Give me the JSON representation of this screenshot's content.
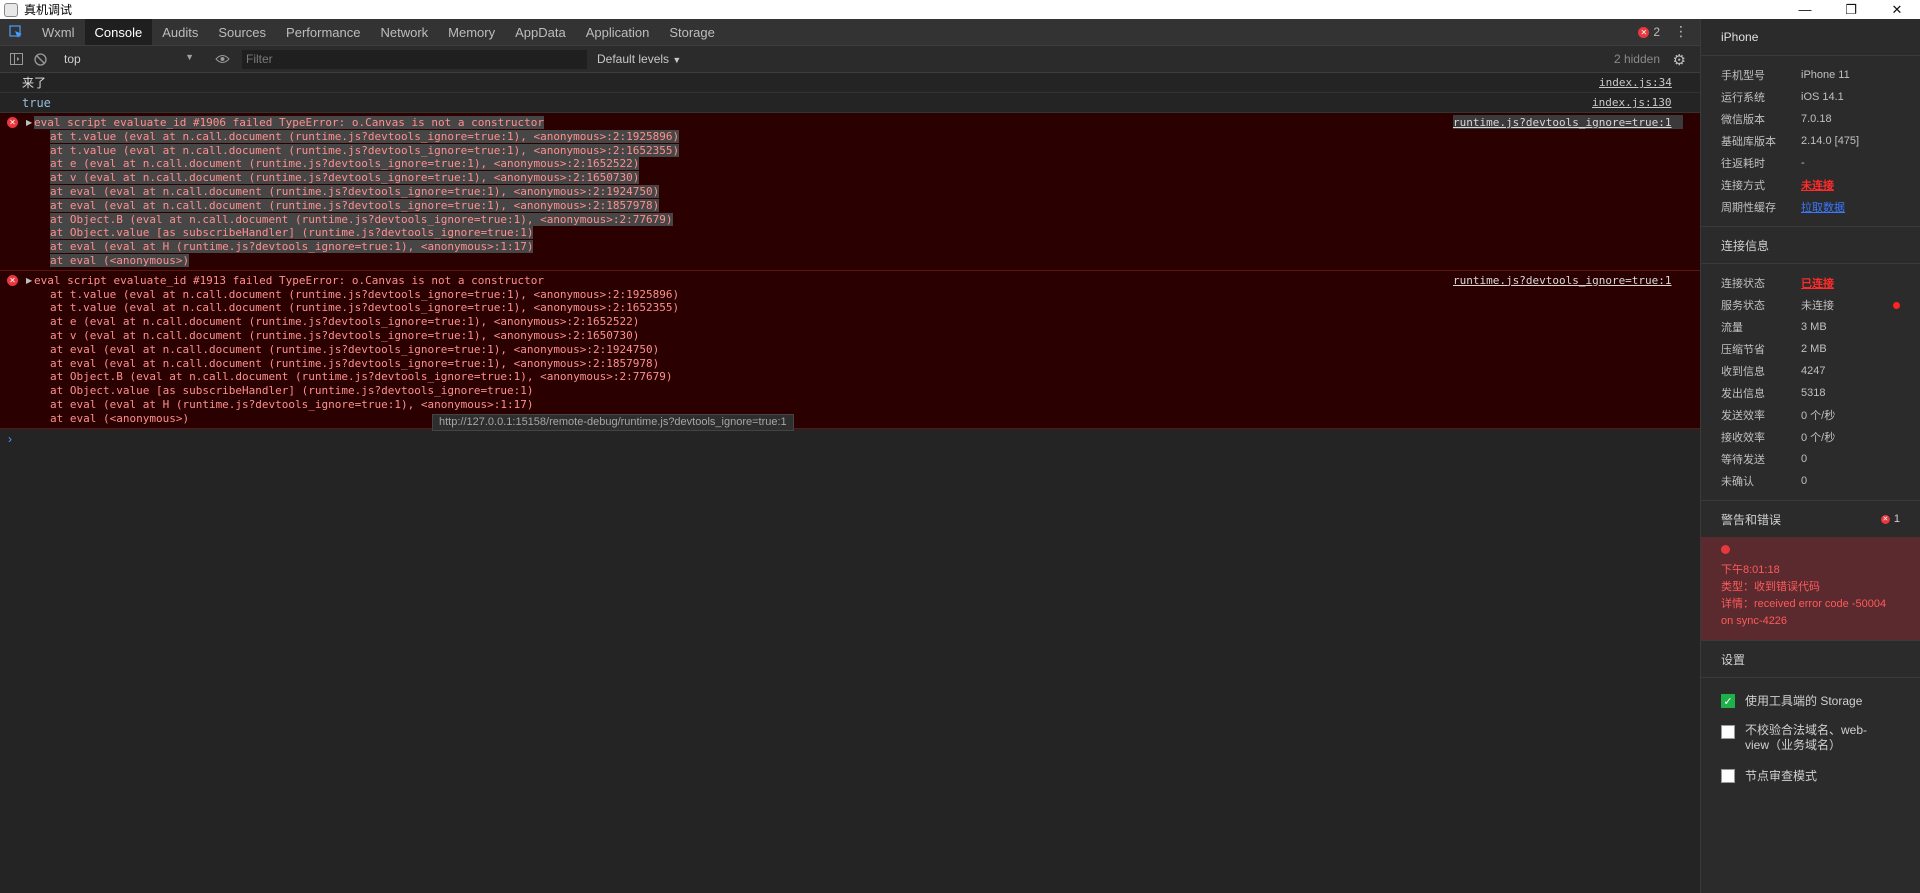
{
  "window": {
    "title": "真机调试",
    "controls": [
      "—",
      "❐",
      "✕"
    ]
  },
  "tabs": [
    "Wxml",
    "Console",
    "Audits",
    "Sources",
    "Performance",
    "Network",
    "Memory",
    "AppData",
    "Application",
    "Storage"
  ],
  "active_tab": "Console",
  "error_badge": "2",
  "toolbar": {
    "context": "top",
    "filter_placeholder": "Filter",
    "levels": "Default levels",
    "hidden": "2 hidden"
  },
  "console": {
    "logs": [
      {
        "text": "来了",
        "source": "index.js:34"
      },
      {
        "text": "true",
        "source": "index.js:130"
      }
    ],
    "errors": [
      {
        "message": "eval script evaluate_id #1906 failed TypeError: o.Canvas is not a constructor",
        "source": "runtime.js?devtools_ignore=true:1",
        "frames": [
          "at t.value (eval at n.call.document (runtime.js?devtools_ignore=true:1), <anonymous>:2:1925896)",
          "at t.value (eval at n.call.document (runtime.js?devtools_ignore=true:1), <anonymous>:2:1652355)",
          "at e (eval at n.call.document (runtime.js?devtools_ignore=true:1), <anonymous>:2:1652522)",
          "at v (eval at n.call.document (runtime.js?devtools_ignore=true:1), <anonymous>:2:1650730)",
          "at eval (eval at n.call.document (runtime.js?devtools_ignore=true:1), <anonymous>:2:1924750)",
          "at eval (eval at n.call.document (runtime.js?devtools_ignore=true:1), <anonymous>:2:1857978)",
          "at Object.B (eval at n.call.document (runtime.js?devtools_ignore=true:1), <anonymous>:2:77679)",
          "at Object.value [as subscribeHandler] (runtime.js?devtools_ignore=true:1)",
          "at eval (eval at H (runtime.js?devtools_ignore=true:1), <anonymous>:1:17)",
          "at eval (<anonymous>)"
        ]
      },
      {
        "message": "eval script evaluate_id #1913 failed TypeError: o.Canvas is not a constructor",
        "source": "runtime.js?devtools_ignore=true:1",
        "frames": [
          "at t.value (eval at n.call.document (runtime.js?devtools_ignore=true:1), <anonymous>:2:1925896)",
          "at t.value (eval at n.call.document (runtime.js?devtools_ignore=true:1), <anonymous>:2:1652355)",
          "at e (eval at n.call.document (runtime.js?devtools_ignore=true:1), <anonymous>:2:1652522)",
          "at v (eval at n.call.document (runtime.js?devtools_ignore=true:1), <anonymous>:2:1650730)",
          "at eval (eval at n.call.document (runtime.js?devtools_ignore=true:1), <anonymous>:2:1924750)",
          "at eval (eval at n.call.document (runtime.js?devtools_ignore=true:1), <anonymous>:2:1857978)",
          "at Object.B (eval at n.call.document (runtime.js?devtools_ignore=true:1), <anonymous>:2:77679)",
          "at Object.value [as subscribeHandler] (runtime.js?devtools_ignore=true:1)",
          "at eval (eval at H (runtime.js?devtools_ignore=true:1), <anonymous>:1:17)",
          "at eval (<anonymous>)"
        ]
      }
    ],
    "tooltip": "http://127.0.0.1:15158/remote-debug/runtime.js?devtools_ignore=true:1"
  },
  "sidebar": {
    "device": "iPhone",
    "device_info": [
      {
        "k": "手机型号",
        "v": "iPhone 11"
      },
      {
        "k": "运行系统",
        "v": "iOS 14.1"
      },
      {
        "k": "微信版本",
        "v": "7.0.18"
      },
      {
        "k": "基础库版本",
        "v": "2.14.0 [475]"
      },
      {
        "k": "往返耗时",
        "v": "-"
      },
      {
        "k": "连接方式",
        "v": "未连接"
      },
      {
        "k": "周期性缓存",
        "v": "拉取数据"
      }
    ],
    "conn_title": "连接信息",
    "conn_info": [
      {
        "k": "连接状态",
        "v": "已连接"
      },
      {
        "k": "服务状态",
        "v": "未连接"
      },
      {
        "k": "流量",
        "v": "3 MB"
      },
      {
        "k": "压缩节省",
        "v": "2 MB"
      },
      {
        "k": "收到信息",
        "v": "4247"
      },
      {
        "k": "发出信息",
        "v": "5318"
      },
      {
        "k": "发送效率",
        "v": "0 个/秒"
      },
      {
        "k": "接收效率",
        "v": "0 个/秒"
      },
      {
        "k": "等待发送",
        "v": "0"
      },
      {
        "k": "未确认",
        "v": "0"
      }
    ],
    "warnings_title": "警告和错误",
    "warnings_count": "1",
    "warning": {
      "time": "下午8:01:18",
      "type": "类型：收到错误代码",
      "detail": "详情：received error code -50004 on sync-4226"
    },
    "settings_title": "设置",
    "settings": [
      {
        "label": "使用工具端的 Storage",
        "checked": true
      },
      {
        "label": "不校验合法域名、web-view（业务域名）",
        "checked": false
      },
      {
        "label": "节点审查模式",
        "checked": false
      }
    ]
  },
  "colors": {
    "error_text": "#ff8f8f",
    "error_bg": "#2a0000",
    "accent_red": "#ff2b2b",
    "link_blue": "#3a78ff",
    "check_green": "#20b04b"
  }
}
